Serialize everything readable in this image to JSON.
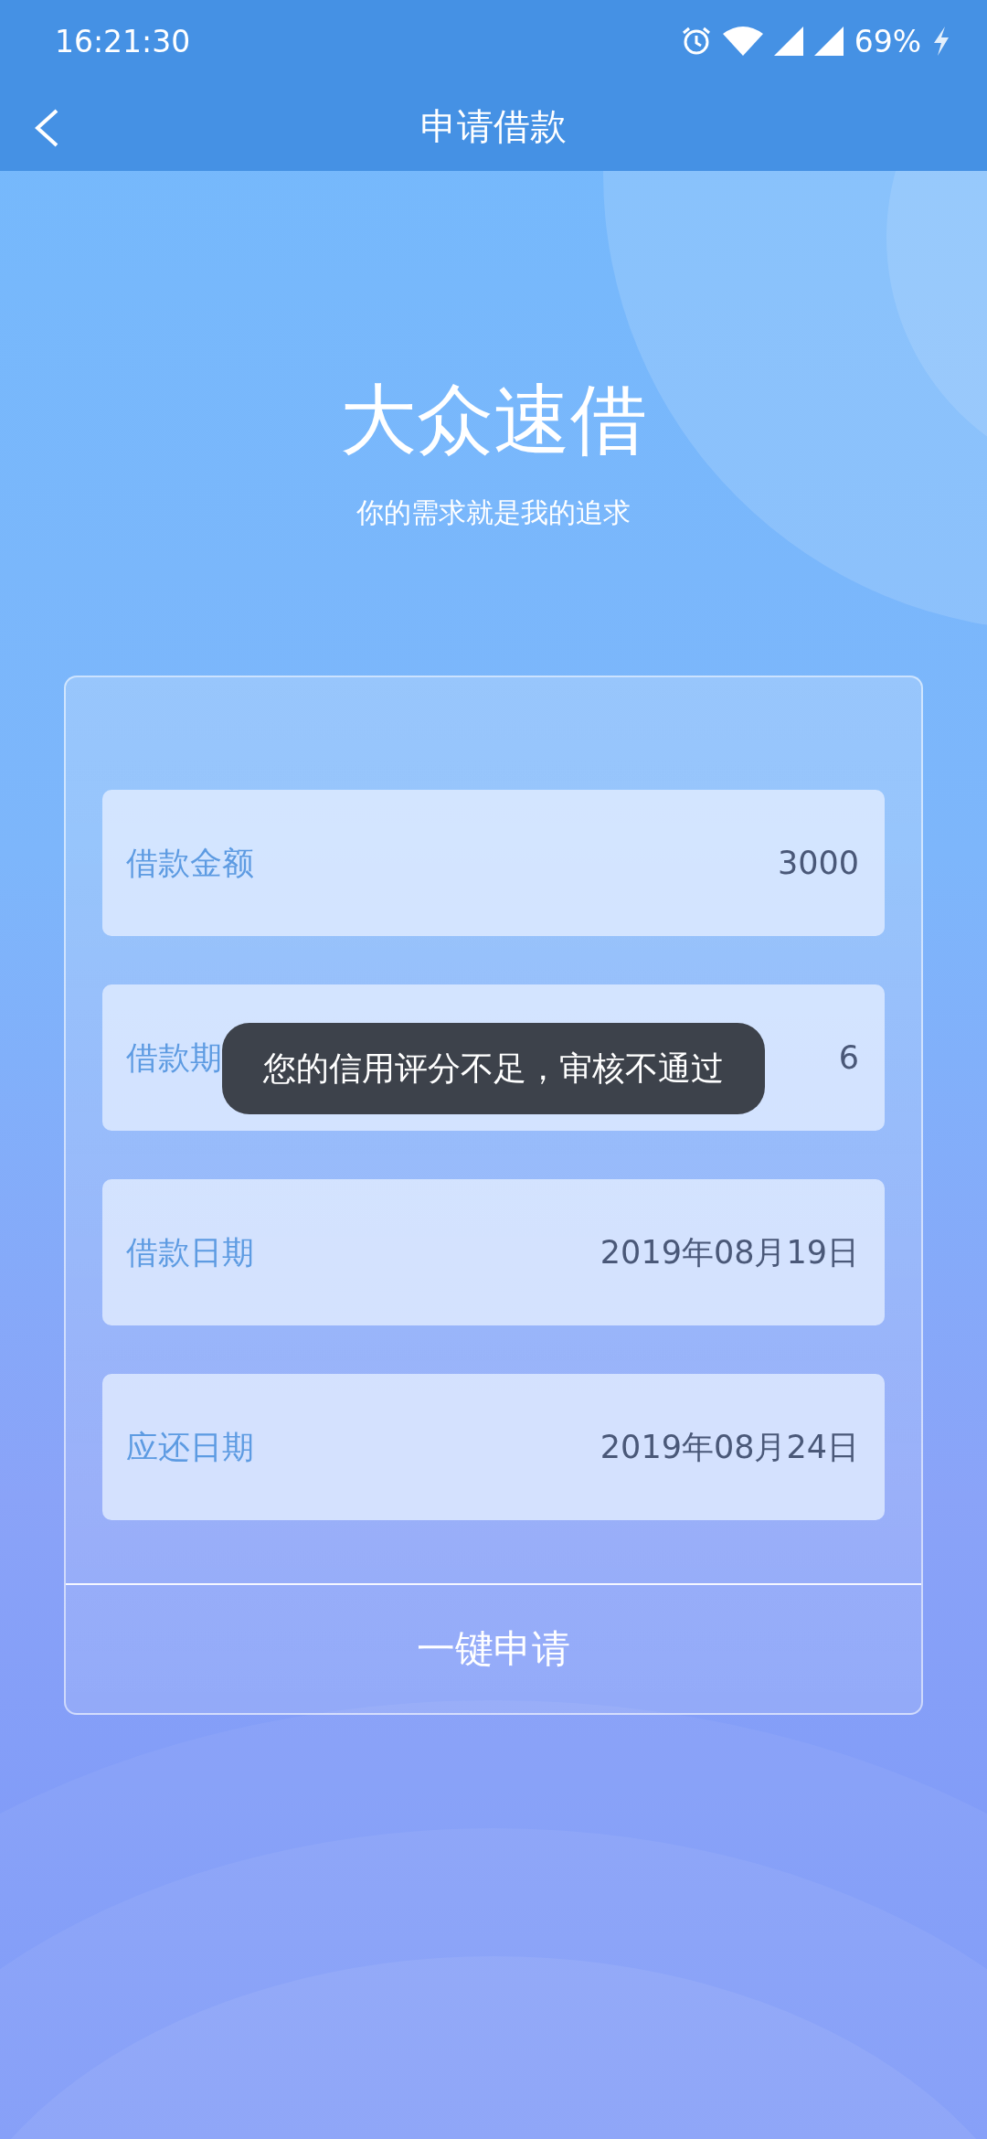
{
  "status_bar": {
    "time": "16:21:30",
    "battery": "69%"
  },
  "nav": {
    "title": "申请借款"
  },
  "hero": {
    "title": "大众速借",
    "subtitle": "你的需求就是我的追求"
  },
  "fields": [
    {
      "label": "借款金额",
      "value": "3000"
    },
    {
      "label": "借款期",
      "value": "6"
    },
    {
      "label": "借款日期",
      "value": "2019年08月19日"
    },
    {
      "label": "应还日期",
      "value": "2019年08月24日"
    }
  ],
  "submit_button": "一键申请",
  "toast": "您的信用评分不足，审核不通过"
}
